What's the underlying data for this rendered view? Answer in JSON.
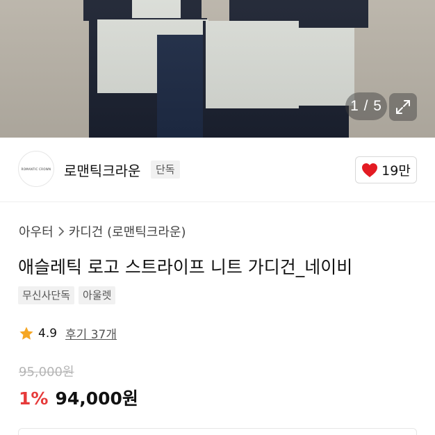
{
  "gallery": {
    "counter": "1 / 5",
    "expand_icon": "expand-icon"
  },
  "brand": {
    "name": "로맨틱크라운",
    "badge": "단독",
    "logo_text": "ROMANTIC CROWN"
  },
  "like": {
    "icon": "heart-icon",
    "icon_color": "#e31b23",
    "count": "19만"
  },
  "product": {
    "breadcrumb": [
      "아우터",
      "카디건 (로맨틱크라운)"
    ],
    "title": "애슬레틱 로고 스트라이프 니트 가디건_네이비",
    "tags": [
      "무신사단독",
      "아울렛"
    ],
    "rating": "4.9",
    "review_link": "후기 37개",
    "original_price": "95,000원",
    "discount": "1%",
    "price": "94,000원"
  },
  "colors": {
    "discount": "#e63a3a",
    "star": "#f5a623"
  }
}
